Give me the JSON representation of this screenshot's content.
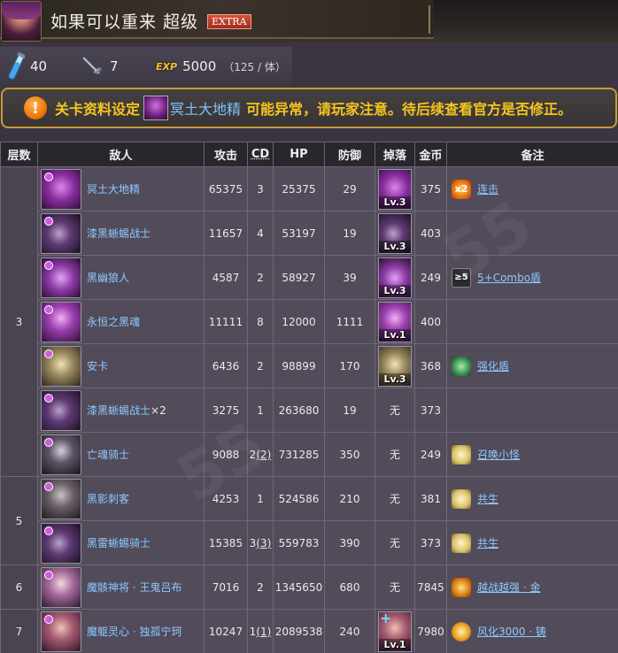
{
  "header": {
    "title": "如果可以重来 超级",
    "badge": "EXTRA"
  },
  "stats": {
    "stamina": "40",
    "stamina_icon": "stamina-vial-icon",
    "rounds": "7",
    "rounds_icon": "sword-icon",
    "exp_label": "EXP",
    "exp_value": "5000",
    "exp_per": "（125 / 体）"
  },
  "warning": {
    "icon": "!",
    "prefix": "关卡资料设定",
    "link": "冥土大地精",
    "suffix": "可能异常，请玩家注意。待后续查看官方是否修正。"
  },
  "table": {
    "headers": {
      "floor": "层数",
      "enemy": "敌人",
      "attack": "攻击",
      "cd": "CD",
      "hp": "HP",
      "defense": "防御",
      "drop": "掉落",
      "coin": "金币",
      "note": "备注"
    },
    "floors": {
      "f3": "3",
      "f5": "5",
      "f6": "6",
      "f7": "7"
    },
    "rows": [
      {
        "name": "冥土大地精",
        "suffix": "",
        "attack": "65375",
        "cd": "3",
        "cd_paren": "",
        "hp": "25375",
        "defense": "29",
        "drop_lv": "Lv.3",
        "coin": "375",
        "note": "连击",
        "note_icon_text": "x2"
      },
      {
        "name": "漆黑蜥蜴战士",
        "suffix": "",
        "attack": "11657",
        "cd": "4",
        "cd_paren": "",
        "hp": "53197",
        "defense": "19",
        "drop_lv": "Lv.3",
        "coin": "403",
        "note": "",
        "note_icon_text": ""
      },
      {
        "name": "黑幽狼人",
        "suffix": "",
        "attack": "4587",
        "cd": "2",
        "cd_paren": "",
        "hp": "58927",
        "defense": "39",
        "drop_lv": "Lv.3",
        "coin": "249",
        "note": "5+Combo盾",
        "note_icon_text": "≥5"
      },
      {
        "name": "永恒之黑魂",
        "suffix": "",
        "attack": "11111",
        "cd": "8",
        "cd_paren": "",
        "hp": "12000",
        "defense": "1111",
        "drop_lv": "Lv.1",
        "coin": "400",
        "note": "",
        "note_icon_text": ""
      },
      {
        "name": "安卡",
        "suffix": "",
        "attack": "6436",
        "cd": "2",
        "cd_paren": "",
        "hp": "98899",
        "defense": "170",
        "drop_lv": "Lv.3",
        "coin": "368",
        "note": "强化盾",
        "note_icon_text": ""
      },
      {
        "name": "漆黑蜥蜴战士",
        "suffix": " ×2",
        "attack": "3275",
        "cd": "1",
        "cd_paren": "",
        "hp": "263680",
        "defense": "19",
        "drop_text": "无",
        "coin": "373",
        "note": "",
        "note_icon_text": ""
      },
      {
        "name": "亡魂骑士",
        "suffix": "",
        "attack": "9088",
        "cd": "2",
        "cd_paren": "(2)",
        "hp": "731285",
        "defense": "350",
        "drop_text": "无",
        "coin": "249",
        "note": "召唤小怪",
        "note_icon_text": ""
      },
      {
        "name": "黑影刺客",
        "suffix": "",
        "attack": "4253",
        "cd": "1",
        "cd_paren": "",
        "hp": "524586",
        "defense": "210",
        "drop_text": "无",
        "coin": "381",
        "note": "共生",
        "note_icon_text": ""
      },
      {
        "name": "黑雷蜥蜴骑士",
        "suffix": "",
        "attack": "15385",
        "cd": "3",
        "cd_paren": "(3)",
        "hp": "559783",
        "defense": "390",
        "drop_text": "无",
        "coin": "373",
        "note": "共生",
        "note_icon_text": ""
      },
      {
        "name": "魔骸神将 · 王鬼吕布",
        "suffix": "",
        "attack": "7016",
        "cd": "2",
        "cd_paren": "",
        "hp": "1345650",
        "defense": "680",
        "drop_text": "无",
        "coin": "7845",
        "note": "越战越强 · 金",
        "note_icon_text": ""
      },
      {
        "name": "魔躯灵心 · 独孤宁珂",
        "suffix": "",
        "attack": "10247",
        "cd": "1",
        "cd_paren": "(1)",
        "hp": "2089538",
        "defense": "240",
        "drop_lv": "Lv.1",
        "coin": "7980",
        "note": "风化3000 · 铸",
        "note_icon_text": ""
      }
    ]
  },
  "watermark": "55"
}
